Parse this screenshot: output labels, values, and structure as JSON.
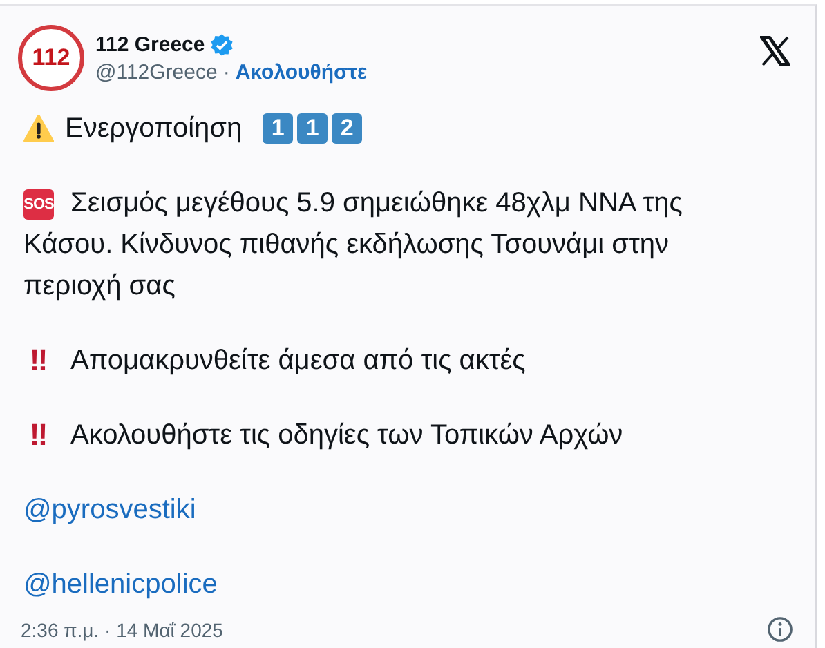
{
  "account": {
    "avatar_text": "112",
    "name": "112 Greece",
    "verified": true,
    "handle": "@112Greece",
    "separator": "·",
    "follow": "Ακολουθήστε"
  },
  "body": [
    {
      "kind": "heading",
      "text": "Ενεργοποίηση",
      "keycaps": [
        "1",
        "1",
        "2"
      ]
    },
    {
      "kind": "alert",
      "badge": "SOS",
      "text": "Σεισμός μεγέθους 5.9 σημειώθηκε 48χλμ ΝΝΑ της Κάσου. Κίνδυνος πιθανής εκδήλωσης Τσουνάμι στην περιοχή σας"
    },
    {
      "kind": "bullet",
      "mark": "‼",
      "text": "Απομακρυνθείτε άμεσα από τις ακτές"
    },
    {
      "kind": "bullet",
      "mark": "‼",
      "text": "Ακολουθήστε τις οδηγίες των Τοπικών Αρχών"
    },
    {
      "kind": "mention",
      "text": "@pyrosvestiki"
    },
    {
      "kind": "mention",
      "text": "@hellenicpolice"
    }
  ],
  "timestamp": "2:36 π.μ. · 14 Μαΐ 2025"
}
